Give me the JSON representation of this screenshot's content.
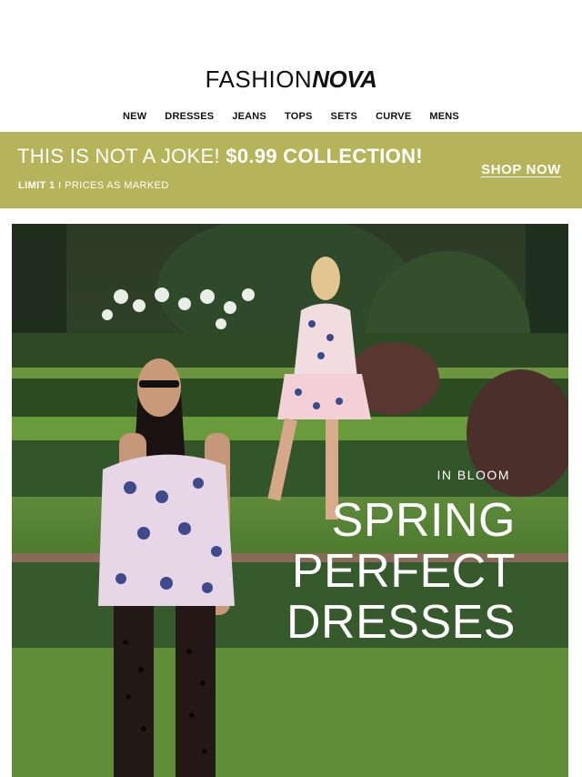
{
  "logo": {
    "light": "FASHION",
    "bold": "NOVA"
  },
  "nav": [
    "NEW",
    "DRESSES",
    "JEANS",
    "TOPS",
    "SETS",
    "CURVE",
    "MENS"
  ],
  "promo": {
    "headline_light": "THIS IS NOT A JOKE! ",
    "headline_strong": "$0.99 COLLECTION!",
    "limit": "LIMIT 1",
    "separator": " I ",
    "prices": "PRICES AS MARKED",
    "cta": "SHOP NOW",
    "color": "#b6b45a"
  },
  "hero": {
    "kicker": "IN BLOOM",
    "title_lines": [
      "SPRING",
      "PERFECT",
      "DRESSES"
    ]
  }
}
